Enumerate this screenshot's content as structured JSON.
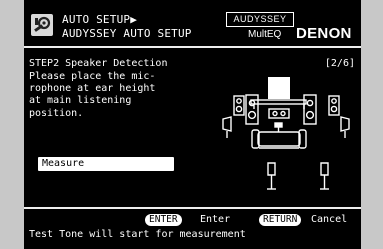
{
  "header": {
    "line1": "AUTO SETUP▶",
    "line2": "AUDYSSEY AUTO SETUP",
    "brand_audyssey": "AUDYSSEY",
    "brand_multeq": "MultEQ",
    "brand_denon": "DENON",
    "icon": "setup-tools-icon"
  },
  "main": {
    "step_title": "STEP2 Speaker Detection",
    "page_indicator": "[2/6]",
    "instruction": "Please place the mic-\nrophone at ear height\nat main listening\nposition.",
    "measure_label": "Measure"
  },
  "footer": {
    "enter_key": "ENTER",
    "enter_label": "Enter",
    "return_key": "RETURN",
    "return_label": "Cancel",
    "status": "Test Tone will start for measurement"
  },
  "colors": {
    "screen_bg": "#000000",
    "text": "#ffffff",
    "bezel": "#c8c8c8"
  }
}
